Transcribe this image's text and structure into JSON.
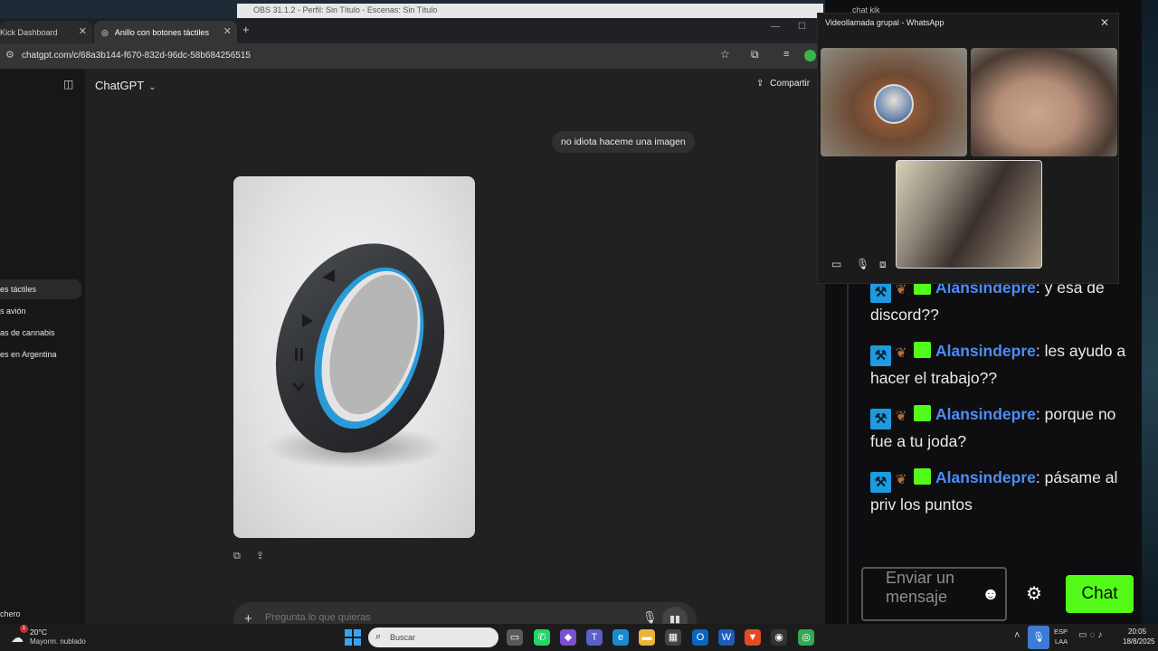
{
  "browser": {
    "tabs": [
      {
        "label": "Kick Dashboard"
      },
      {
        "label": "Anillo con botones táctiles"
      }
    ],
    "url": "chatgpt.com/c/68a3b144-f670-832d-96dc-58b684256515"
  },
  "obs": {
    "title": "OBS 31.1.2 - Perfil: Sin Título - Escenas: Sin Título"
  },
  "chatgpt": {
    "model_label": "ChatGPT",
    "share_label": "Compartir",
    "sidebar_items": [
      {
        "label": "es táctiles"
      },
      {
        "label": "s avión"
      },
      {
        "label": "as de cannabis"
      },
      {
        "label": "es en Argentina"
      }
    ],
    "sidebar_bottom": "chero",
    "user_message": "no idiota haceme una imagen",
    "composer_placeholder": "Pregunta lo que quieras"
  },
  "kick": {
    "window_title": "chat kik",
    "messages": [
      {
        "user": "Alansindepre",
        "text": ": y esa de discord??"
      },
      {
        "user": "Alansindepre",
        "text": ": les ayudo a hacer el trabajo??"
      },
      {
        "user": "Alansindepre",
        "text": ": porque no fue a tu joda?"
      },
      {
        "user": "Alansindepre",
        "text": ": pásame al priv los puntos"
      }
    ],
    "input_placeholder": "Enviar un mensaje",
    "send_label": "Chat",
    "colors": {
      "accent": "#53fc18",
      "username": "#4c8cf5"
    }
  },
  "whatsapp": {
    "title": "Videollamada grupal - WhatsApp"
  },
  "taskbar": {
    "weather_temp": "20°C",
    "weather_desc": "Mayorm. nublado",
    "weather_badge": "1",
    "search_label": "Buscar",
    "lang_top": "ESP",
    "lang_bottom": "LAA",
    "time": "20:05",
    "date": "18/8/2025"
  }
}
